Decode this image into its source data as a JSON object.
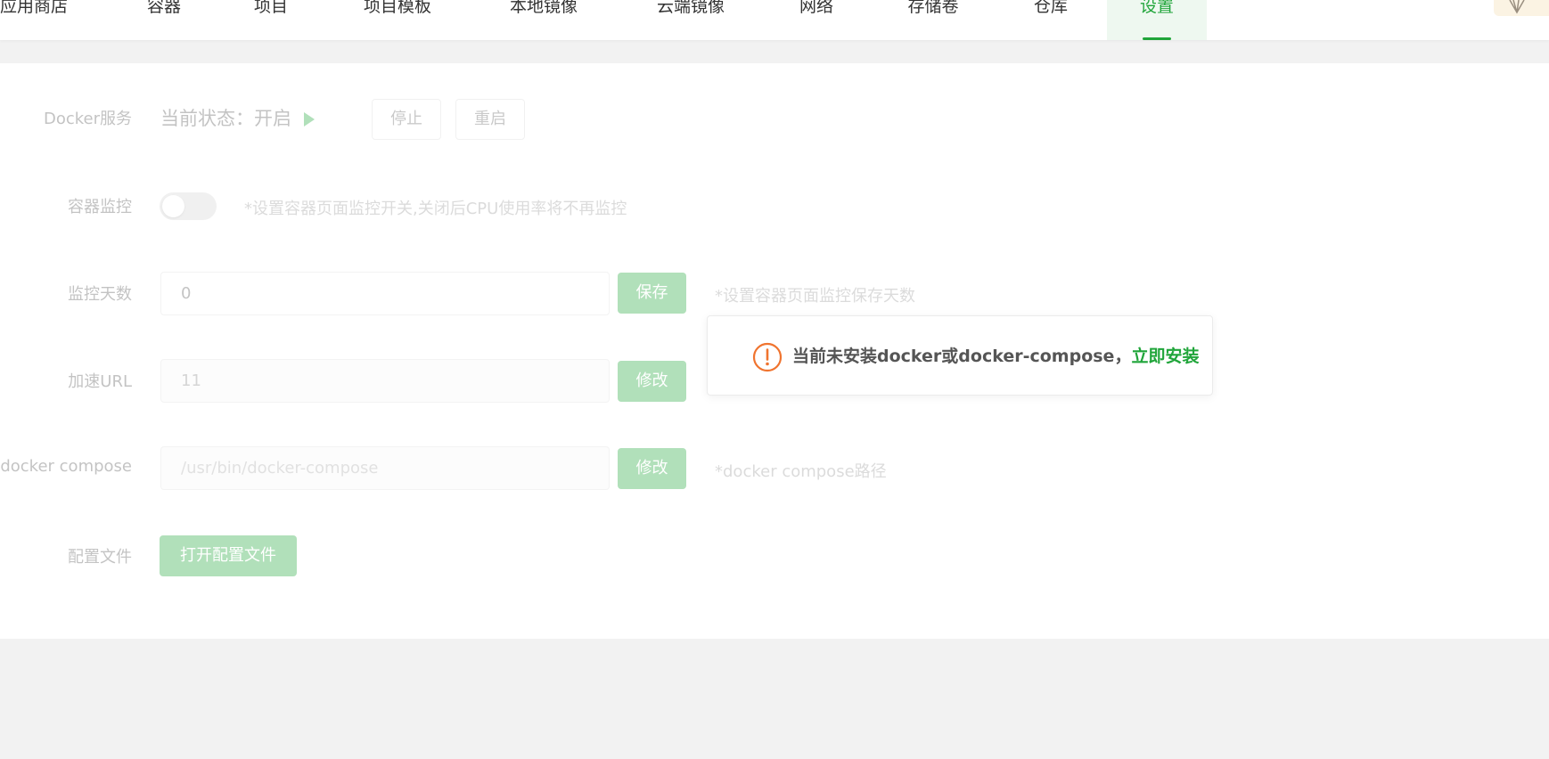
{
  "tabs": [
    {
      "label": "应用商店",
      "active": false
    },
    {
      "label": "容器",
      "active": false
    },
    {
      "label": "项目",
      "active": false
    },
    {
      "label": "项目模板",
      "active": false
    },
    {
      "label": "本地镜像",
      "active": false
    },
    {
      "label": "云端镜像",
      "active": false
    },
    {
      "label": "网络",
      "active": false
    },
    {
      "label": "存储卷",
      "active": false
    },
    {
      "label": "仓库",
      "active": false
    },
    {
      "label": "设置",
      "active": true
    }
  ],
  "settings": {
    "docker_service": {
      "label": "Docker服务",
      "status_text": "当前状态：开启",
      "stop_label": "停止",
      "restart_label": "重启"
    },
    "container_monitor": {
      "label": "容器监控",
      "enabled": false,
      "hint": "*设置容器页面监控开关,关闭后CPU使用率将不再监控"
    },
    "monitor_days": {
      "label": "监控天数",
      "value": "0",
      "save_label": "保存",
      "hint": "*设置容器页面监控保存天数"
    },
    "accel_url": {
      "label": "加速URL",
      "value": "11",
      "edit_label": "修改"
    },
    "docker_compose": {
      "label": "docker compose",
      "placeholder": "/usr/bin/docker-compose",
      "edit_label": "修改",
      "hint": "*docker compose路径"
    },
    "config_file": {
      "label": "配置文件",
      "open_label": "打开配置文件"
    }
  },
  "popup": {
    "message": "当前未安装docker或docker-compose，",
    "install_link": "立即安装",
    "icon": "warning-circle-icon"
  },
  "colors": {
    "accent": "#20a53a",
    "warning": "#f0742f"
  }
}
